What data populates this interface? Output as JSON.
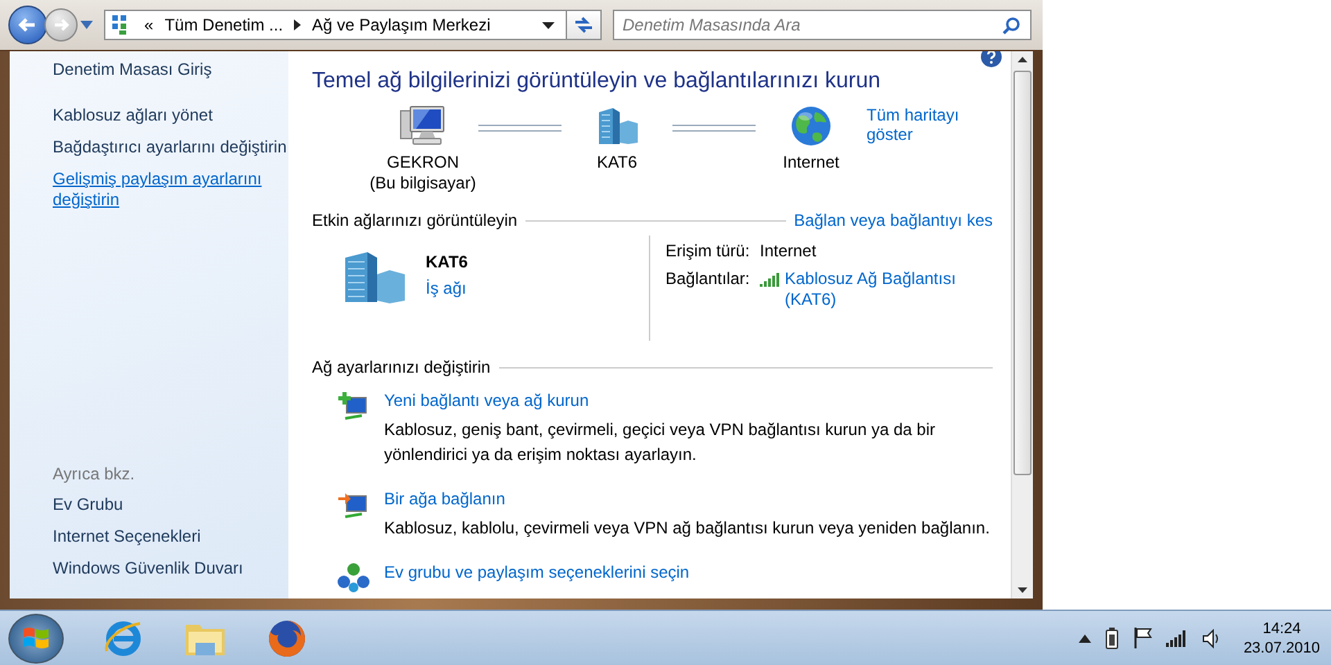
{
  "nav": {
    "overflow": "«",
    "breadcrumb": [
      "Tüm Denetim ...",
      "Ağ ve Paylaşım Merkezi"
    ],
    "search": {
      "placeholder": "Denetim Masasında Ara"
    }
  },
  "sidebar": {
    "items": [
      {
        "label": "Denetim Masası Giriş",
        "hovered": false
      },
      {
        "label": "Kablosuz ağları yönet",
        "hovered": false
      },
      {
        "label": "Bağdaştırıcı ayarlarını değiştirin",
        "hovered": false
      },
      {
        "label": "Gelişmiş paylaşım ayarlarını değiştirin",
        "hovered": true
      }
    ],
    "see_also": {
      "heading": "Ayrıca bkz.",
      "items": [
        "Ev Grubu",
        "Internet Seçenekleri",
        "Windows Güvenlik Duvarı"
      ]
    }
  },
  "main": {
    "title": "Temel ağ bilgilerinizi görüntüleyin ve bağlantılarınızı kurun",
    "map_link": "Tüm haritayı göster",
    "map_nodes": [
      {
        "kind": "computer",
        "label": "GEKRON",
        "sublabel": "(Bu bilgisayar)"
      },
      {
        "kind": "network",
        "label": "KAT6"
      },
      {
        "kind": "internet",
        "label": "Internet"
      }
    ],
    "active_networks": {
      "heading": "Etkin ağlarınızı görüntüleyin",
      "link": "Bağlan veya bağlantıyı kes",
      "network": {
        "name": "KAT6",
        "type": "İş ağı"
      },
      "details": [
        {
          "kind": "text",
          "label": "Erişim türü:",
          "value": "Internet"
        },
        {
          "kind": "wireless",
          "label": "Bağlantılar:",
          "value": "Kablosuz Ağ Bağlantısı (KAT6)"
        }
      ]
    },
    "settings": {
      "heading": "Ağ ayarlarınızı değiştirin",
      "tasks": [
        {
          "kind": "new",
          "title": "Yeni bağlantı veya ağ kurun",
          "description": "Kablosuz, geniş bant, çevirmeli, geçici veya VPN bağlantısı kurun ya da bir yönlendirici ya da erişim noktası ayarlayın."
        },
        {
          "kind": "connect",
          "title": "Bir ağa bağlanın",
          "description": "Kablosuz, kablolu, çevirmeli veya VPN ağ bağlantısı kurun veya yeniden bağlanın."
        },
        {
          "kind": "homegroup",
          "title": "Ev grubu ve paylaşım seçeneklerini seçin"
        }
      ]
    }
  },
  "taskbar": {
    "apps": [
      {
        "kind": "ie"
      },
      {
        "kind": "explorer"
      },
      {
        "kind": "firefox"
      }
    ],
    "clock": {
      "time": "14:24",
      "date": "23.07.2010"
    }
  }
}
